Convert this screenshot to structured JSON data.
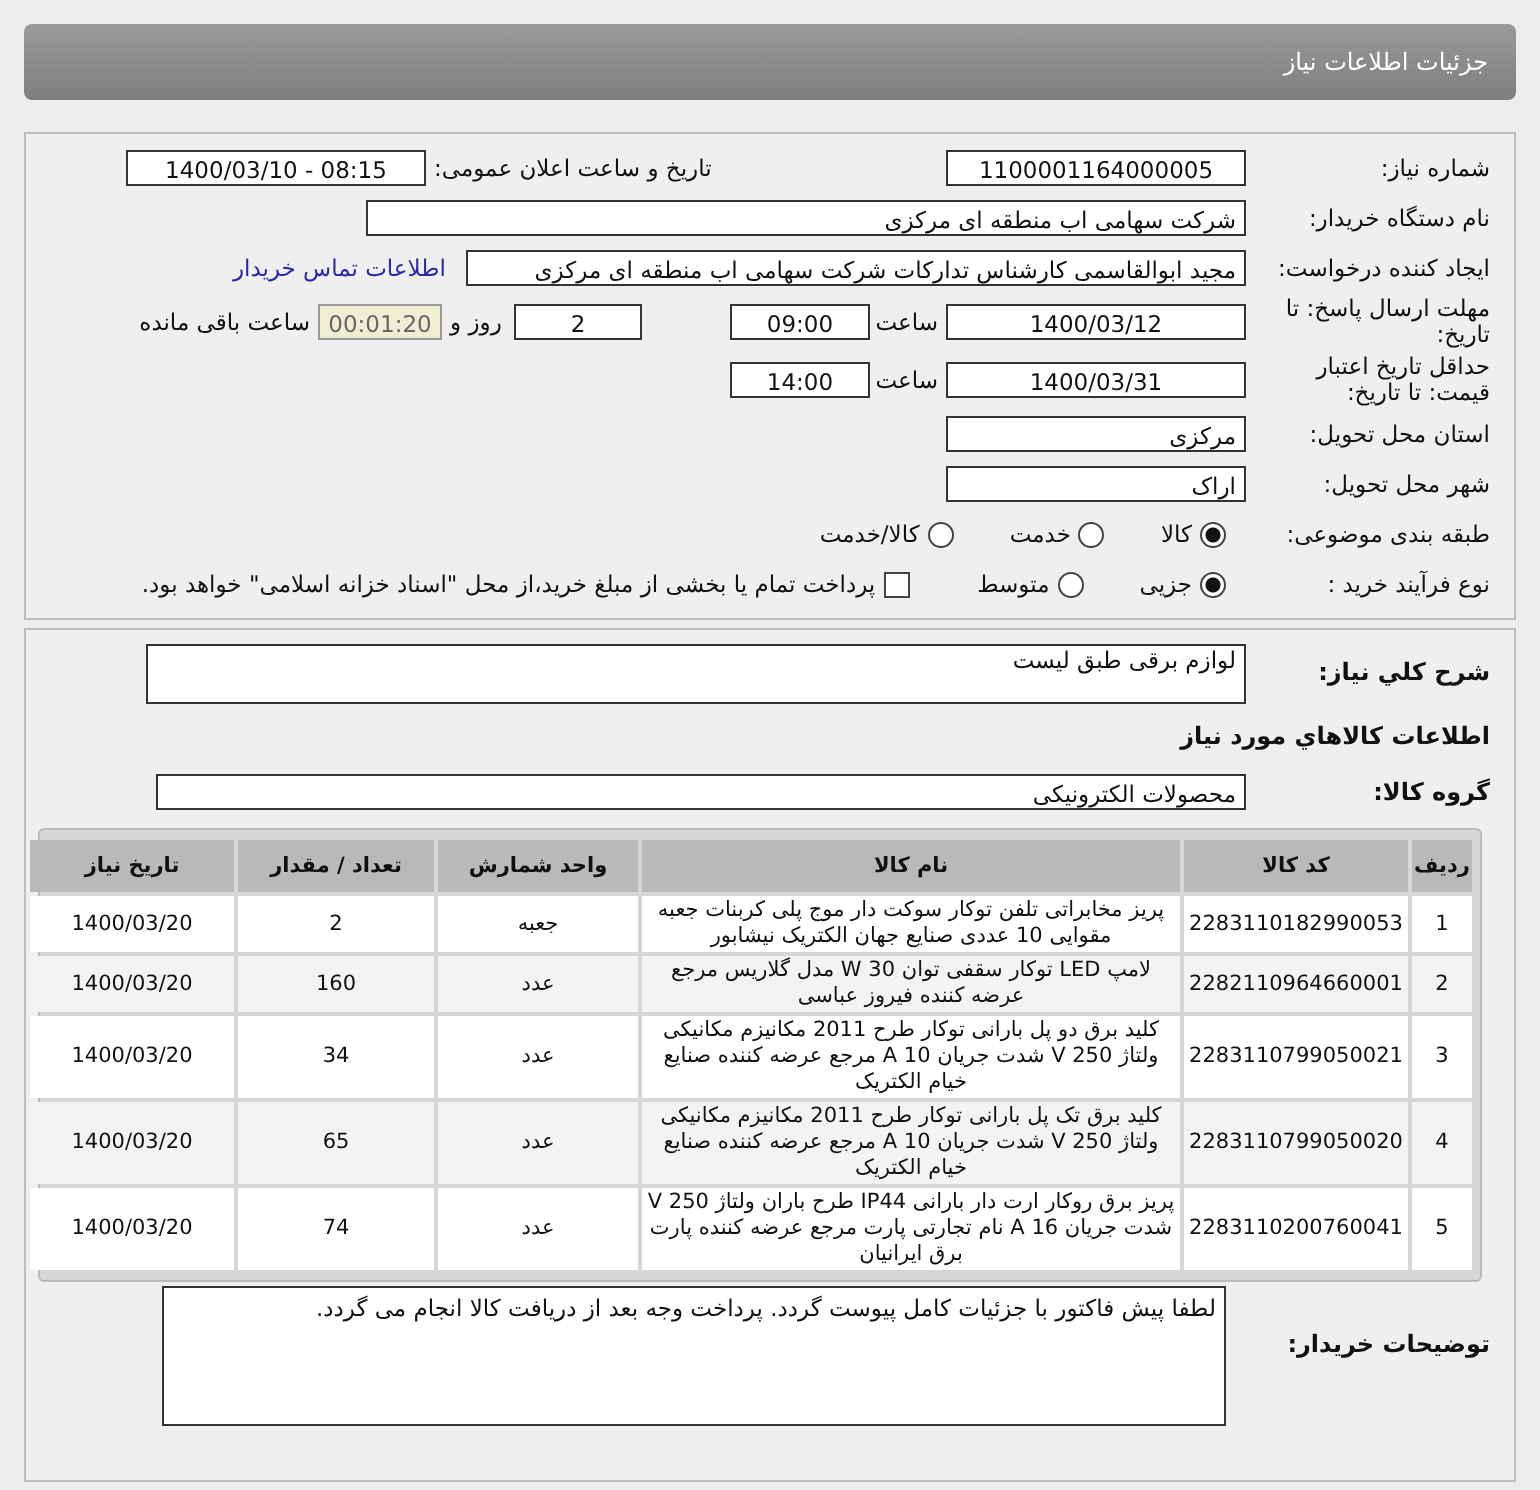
{
  "header": {
    "title": "جزئیات اطلاعات نیاز"
  },
  "details": {
    "need_number": {
      "label": "شماره نیاز:",
      "value": "1100001164000005"
    },
    "announce": {
      "label": "تاریخ و ساعت اعلان عمومی:",
      "value": "1400/03/10 - 08:15"
    },
    "buyer_org": {
      "label": "نام دستگاه خریدار:",
      "value": "شرکت سهامی اب منطقه ای مرکزی"
    },
    "requester": {
      "label": "ایجاد کننده درخواست:",
      "value": "مجید ابوالقاسمی کارشناس تدارکات شرکت سهامی اب منطقه ای مرکزی",
      "link": "اطلاعات تماس خریدار"
    },
    "reply_deadline": {
      "label": "مهلت ارسال پاسخ: تا تاریخ:",
      "date": "1400/03/12",
      "time_label": "ساعت",
      "time": "09:00",
      "days": "2",
      "days_label": "روز و",
      "remaining": "00:01:20",
      "remaining_label": "ساعت باقی مانده"
    },
    "price_validity": {
      "label": "حداقل تاریخ اعتبار قیمت: تا تاریخ:",
      "date": "1400/03/31",
      "time_label": "ساعت",
      "time": "14:00"
    },
    "province": {
      "label": "استان محل تحویل:",
      "value": "مرکزی"
    },
    "city": {
      "label": "شهر محل تحویل:",
      "value": "اراک"
    },
    "category": {
      "label": "طبقه بندی موضوعی:",
      "options": [
        {
          "label": "کالا",
          "selected": true
        },
        {
          "label": "خدمت",
          "selected": false
        },
        {
          "label": "کالا/خدمت",
          "selected": false
        }
      ]
    },
    "process": {
      "label": "نوع فرآیند خرید :",
      "options": [
        {
          "label": "جزیی",
          "selected": true
        },
        {
          "label": "متوسط",
          "selected": false
        }
      ],
      "treasury": {
        "label": "پرداخت تمام یا بخشی از مبلغ خرید،از محل \"اسناد خزانه اسلامی\" خواهد بود.",
        "checked": false
      }
    }
  },
  "needs": {
    "description": {
      "label": "شرح کلي نیاز:",
      "value": "لوازم برقی طبق لیست"
    },
    "section_title": "اطلاعات کالاهاي مورد نیاز",
    "goods_group": {
      "label": "گروه کالا:",
      "value": "محصولات الکترونیکی"
    },
    "table": {
      "columns": [
        "ردیف",
        "کد کالا",
        "نام کالا",
        "واحد شمارش",
        "تعداد / مقدار",
        "تاریخ نیاز"
      ],
      "rows": [
        [
          "1",
          "2283110182990053",
          "پریز مخابراتی تلفن توکار سوکت دار موج پلی کربنات جعبه مقوایی 10 عددی صنایع جهان الکتریک نیشابور",
          "جعبه",
          "2",
          "1400/03/20"
        ],
        [
          "2",
          "2282110964660001",
          "لامپ LED توکار سقفی توان 30 W مدل گلاریس مرجع عرضه کننده فیروز عباسی",
          "عدد",
          "160",
          "1400/03/20"
        ],
        [
          "3",
          "2283110799050021",
          "کلید برق دو پل بارانی توکار طرح 2011 مکانیزم مکانیکی ولتاژ 250 V شدت جریان 10 A مرجع عرضه کننده صنایع خیام الکتریک",
          "عدد",
          "34",
          "1400/03/20"
        ],
        [
          "4",
          "2283110799050020",
          "کلید برق تک پل بارانی توکار طرح 2011 مکانیزم مکانیکی ولتاژ 250 V شدت جریان 10 A مرجع عرضه کننده صنایع خیام الکتریک",
          "عدد",
          "65",
          "1400/03/20"
        ],
        [
          "5",
          "2283110200760041",
          "پریز برق روکار ارت دار بارانی IP44 طرح باران ولتاژ 250 V شدت جریان 16 A نام تجارتی پارت مرجع عرضه کننده پارت برق ایرانیان",
          "عدد",
          "74",
          "1400/03/20"
        ]
      ]
    },
    "buyer_notes": {
      "label": "توضیحات خریدار:",
      "value": "لطفا پیش فاکتور با جزئیات کامل پیوست گردد. پرداخت وجه بعد از دریافت کالا انجام می گردد."
    }
  }
}
